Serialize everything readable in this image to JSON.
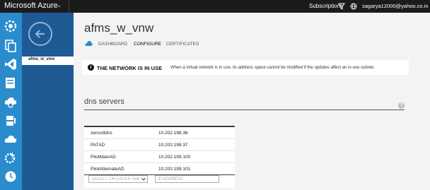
{
  "topbar": {
    "brand": "Microsoft Azure",
    "subscriptions_label": "Subscriptions",
    "user_email": "sagarya12000@yahoo.co.in"
  },
  "sidebar": {
    "icons": [
      "settings-gear-icon",
      "network-pages-icon",
      "visual-studio-icon",
      "database-icon",
      "cloud-gear-icon",
      "box-stack-icon",
      "cloud-upload-icon",
      "gear-bolt-icon",
      "clock-icon"
    ],
    "subnav_item": "afms_w_vnw"
  },
  "page": {
    "title": "afms_w_vnw",
    "tabs": [
      {
        "label": "DASHBOARD"
      },
      {
        "label": "CONFIGURE"
      },
      {
        "label": "CERTIFICATES"
      }
    ]
  },
  "notice": {
    "heading": "THE NETWORK IS IN USE",
    "text": "When a virtual network is in use, its address space cannot be modified if the updates affect an in-use subnet."
  },
  "dns": {
    "section_title": "dns servers",
    "rows": [
      {
        "name": "zencolldns",
        "ip": "10.202.198.36"
      },
      {
        "name": "PATAD",
        "ip": "10.202.198.37"
      },
      {
        "name": "PilotMainAD",
        "ip": "10.202.199.100"
      },
      {
        "name": "PilotAlternateAD",
        "ip": "10.202.199.101"
      }
    ],
    "name_placeholder": "SELECT OR ENTER NAME",
    "ip_placeholder": "IP ADDRESS"
  },
  "colors": {
    "topbar": "#1b1b1b",
    "nav": "#2a8ccd",
    "subpanel": "#1e5a94"
  }
}
